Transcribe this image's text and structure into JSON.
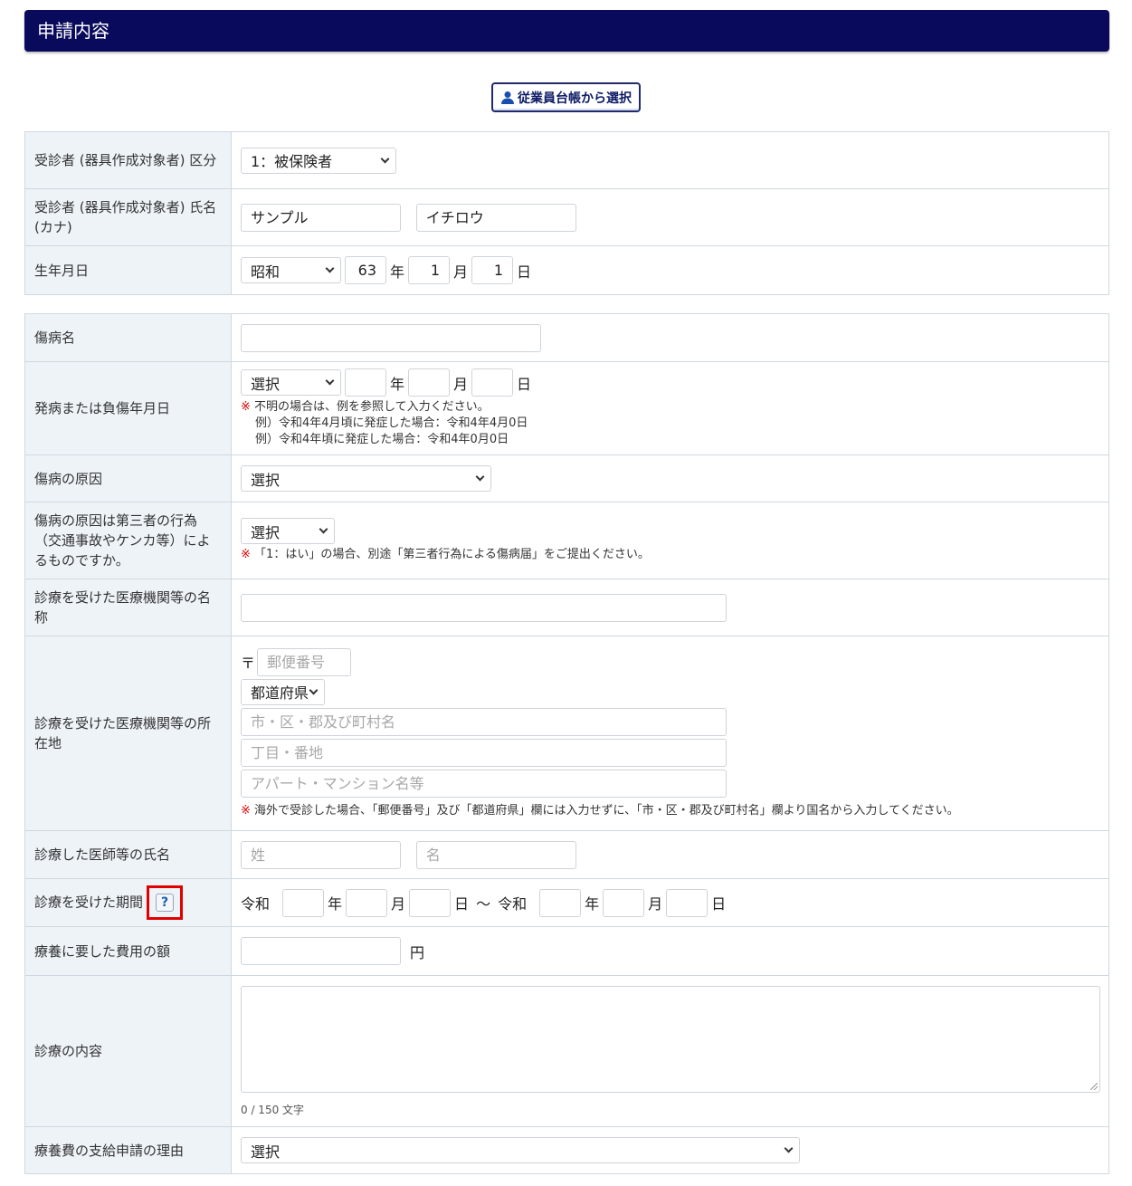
{
  "header": {
    "title": "申請内容"
  },
  "employee_button": {
    "label": "従業員台帳から選択"
  },
  "section1": {
    "patient_type": {
      "label": "受診者 (器具作成対象者) 区分",
      "value": "1：被保険者"
    },
    "patient_name": {
      "label": "受診者 (器具作成対象者) 氏名 (カナ)",
      "last": "サンプル",
      "first": "イチロウ"
    },
    "birth_date": {
      "label": "生年月日",
      "era": "昭和",
      "year": "63",
      "month": "1",
      "day": "1",
      "year_unit": "年",
      "month_unit": "月",
      "day_unit": "日"
    }
  },
  "section2": {
    "injury_name": {
      "label": "傷病名",
      "value": ""
    },
    "onset_date": {
      "label": "発病または負傷年月日",
      "era": "選択",
      "year_unit": "年",
      "month_unit": "月",
      "day_unit": "日",
      "note_mark": "※",
      "note1": "不明の場合は、例を参照して入力ください。",
      "note2": "例）令和4年4月頃に発症した場合：令和4年4月0日",
      "note3": "例）令和4年頃に発症した場合：令和4年0月0日"
    },
    "cause": {
      "label": "傷病の原因",
      "value": "選択"
    },
    "third_party": {
      "label": "傷病の原因は第三者の行為（交通事故やケンカ等）によるものですか。",
      "value": "選択",
      "note_mark": "※",
      "note": "「1：はい」の場合、別途「第三者行為による傷病届」をご提出ください。"
    },
    "facility_name": {
      "label": "診療を受けた医療機関等の名称",
      "value": ""
    },
    "facility_address": {
      "label": "診療を受けた医療機関等の所在地",
      "postal_mark": "〒",
      "postal_placeholder": "郵便番号",
      "prefecture": "都道府県",
      "city_placeholder": "市・区・郡及び町村名",
      "street_placeholder": "丁目・番地",
      "building_placeholder": "アパート・マンション名等",
      "note_mark": "※",
      "note": "海外で受診した場合、「郵便番号」及び「都道府県」欄には入力せずに、「市・区・郡及び町村名」欄より国名から入力してください。"
    },
    "doctor_name": {
      "label": "診療した医師等の氏名",
      "last_placeholder": "姓",
      "first_placeholder": "名"
    },
    "period": {
      "label": "診療を受けた期間",
      "help": "?",
      "era_from": "令和",
      "era_to": "令和",
      "year_unit": "年",
      "month_unit": "月",
      "day_unit": "日",
      "separator": "～"
    },
    "cost": {
      "label": "療養に要した費用の額",
      "unit": "円"
    },
    "content": {
      "label": "診療の内容",
      "counter": "0 / 150 文字"
    },
    "reason": {
      "label": "療養費の支給申請の理由",
      "value": "選択"
    }
  }
}
